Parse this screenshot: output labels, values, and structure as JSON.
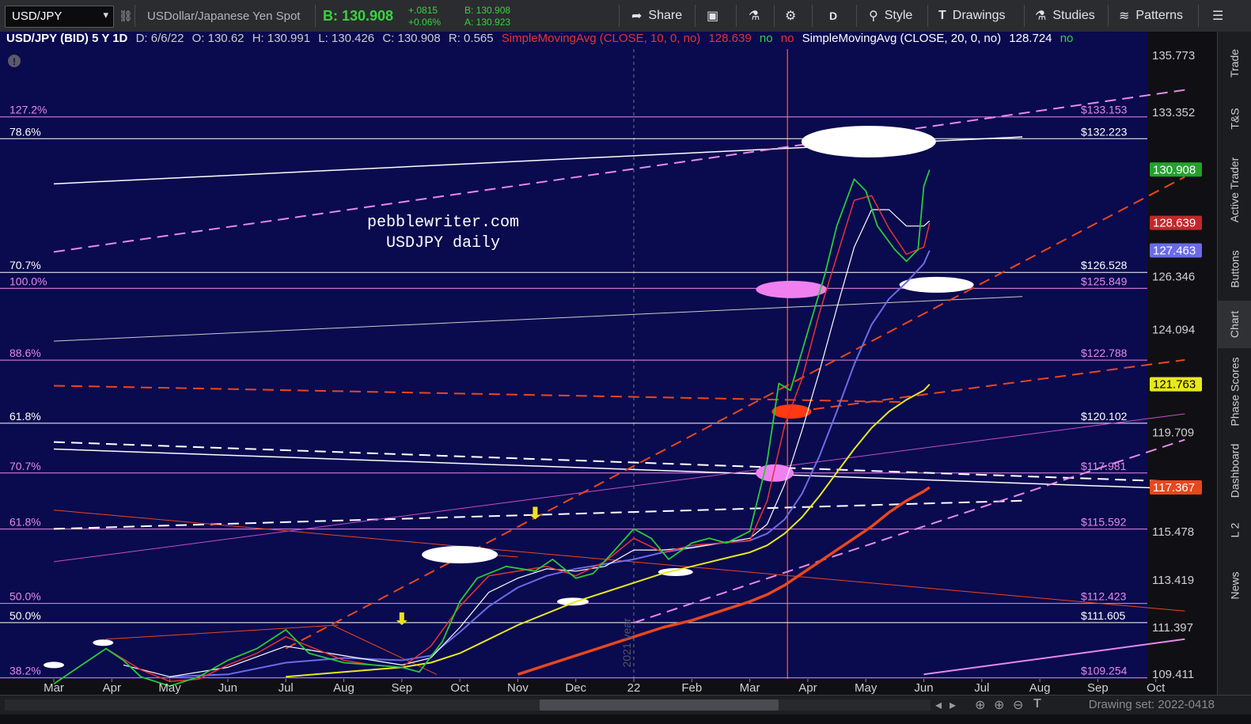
{
  "toolbar": {
    "symbol": "USD/JPY",
    "symbol_dropdown": "▾",
    "description": "USDollar/Japanese Yen Spot",
    "bid": "B: 130.908",
    "change": "+.0815",
    "change_pct": "+0.06%",
    "bid_small": "B: 130.908",
    "ask_small": "A: 130.923",
    "share": "Share",
    "period": "D",
    "style": "Style",
    "drawings": "Drawings",
    "studies": "Studies",
    "patterns": "Patterns"
  },
  "infobar": {
    "symbol_desc": "USD/JPY (BID) 5 Y 1D",
    "date": "D: 6/6/22",
    "open": "O: 130.62",
    "high": "H: 130.991",
    "low": "L: 130.426",
    "close": "C: 130.908",
    "range": "R: 0.565",
    "sma10": "SimpleMovingAvg (CLOSE, 10, 0, no)",
    "sma10_val": "128.639",
    "no1": "no",
    "no2": "no",
    "sma20": "SimpleMovingAvg (CLOSE, 20, 0, no)",
    "sma20_val": "128.724",
    "no3": "no"
  },
  "sidebar": [
    "Trade",
    "T&S",
    "Active Trader",
    "Buttons",
    "Chart",
    "Phase Scores",
    "Dashboard",
    "L 2",
    "News"
  ],
  "sidebar_active": "Chart",
  "bottombar": {
    "drawing_set": "Drawing set: 2022-0418"
  },
  "chart_data": {
    "type": "line",
    "title": "pebblewriter.com\nUSDJPY daily",
    "title_lines": [
      "pebblewriter.com",
      "USDJPY daily"
    ],
    "xlabel": "",
    "ylabel": "",
    "ylim": [
      109.41,
      135.773
    ],
    "x_tick_labels": [
      "Mar",
      "Apr",
      "May",
      "Jun",
      "Jul",
      "Aug",
      "Sep",
      "Oct",
      "Nov",
      "Dec",
      "22",
      "Feb",
      "Mar",
      "Apr",
      "May",
      "Jun",
      "Jul",
      "Aug",
      "Sep",
      "Oct"
    ],
    "x_tick_months": [
      0,
      1,
      2,
      3,
      4,
      5,
      6,
      7,
      8,
      9,
      10,
      11,
      12,
      13,
      14,
      15,
      16,
      17,
      18,
      19
    ],
    "x_start_label": "Mar 2021",
    "year_label": "2021 year",
    "y_ticks": [
      135.773,
      133.352,
      126.346,
      124.094,
      119.709,
      115.478,
      113.419,
      111.397,
      109.411
    ],
    "y_tick_labels": [
      "135.773",
      "133.352",
      "126.346",
      "124.094",
      "119.709",
      "115.478",
      "113.419",
      "111.397",
      "109.411"
    ],
    "fib_levels": [
      {
        "pct": "127.2%",
        "price": 133.153,
        "label": "$133.153",
        "color": "#e58ae8"
      },
      {
        "pct": "78.6%",
        "price": 132.223,
        "label": "$132.223",
        "color": "#ffffff"
      },
      {
        "pct": "70.7%",
        "price": 126.528,
        "label": "$126.528",
        "color": "#ffffff"
      },
      {
        "pct": "100.0%",
        "price": 125.849,
        "label": "$125.849",
        "color": "#e58ae8"
      },
      {
        "pct": "88.6%",
        "price": 122.788,
        "label": "$122.788",
        "color": "#e58ae8"
      },
      {
        "pct": "61.8%",
        "price": 120.102,
        "label": "$120.102",
        "color": "#ffffff"
      },
      {
        "pct": "70.7%",
        "price": 117.981,
        "label": "$117.981",
        "color": "#e58ae8"
      },
      {
        "pct": "61.8%",
        "price": 115.592,
        "label": "$115.592",
        "color": "#e58ae8"
      },
      {
        "pct": "50.0%",
        "price": 112.423,
        "label": "$112.423",
        "color": "#e58ae8"
      },
      {
        "pct": "50.0%",
        "price": 111.605,
        "label": "$111.605",
        "color": "#ffffff"
      },
      {
        "pct": "38.2%",
        "price": 109.254,
        "label": "$109.254",
        "color": "#e58ae8"
      }
    ],
    "price_badges": [
      {
        "price": 130.908,
        "label": "130.908",
        "bg": "#23a12d",
        "fg": "#ffffff"
      },
      {
        "price": 128.639,
        "label": "128.639",
        "bg": "#c2282b",
        "fg": "#ffffff"
      },
      {
        "price": 127.463,
        "label": "127.463",
        "bg": "#6b6be8",
        "fg": "#ffffff"
      },
      {
        "price": 121.763,
        "label": "121.763",
        "bg": "#e8e81e",
        "fg": "#000000"
      },
      {
        "price": 117.367,
        "label": "117.367",
        "bg": "#e8471e",
        "fg": "#ffffff"
      }
    ],
    "price_series": {
      "name": "",
      "x_months": [
        0,
        0.9,
        1.2,
        1.5,
        2,
        2.5,
        3,
        3.5,
        4,
        4.4,
        5,
        5.5,
        6,
        6.3,
        6.7,
        7,
        7.3,
        7.8,
        8.3,
        8.6,
        9,
        9.3,
        9.6,
        10,
        10.3,
        10.6,
        11,
        11.3,
        11.6,
        12,
        12.3,
        12.5,
        12.7,
        13,
        13.3,
        13.5,
        13.8,
        14,
        14.2,
        14.5,
        14.7,
        14.9,
        15,
        15.1
      ],
      "close": [
        109.0,
        110.5,
        110.0,
        109.3,
        108.9,
        109.3,
        110.0,
        110.5,
        111.3,
        110.3,
        109.9,
        109.8,
        109.7,
        109.5,
        110.8,
        112.5,
        113.5,
        114.0,
        113.8,
        114.3,
        113.5,
        113.7,
        114.5,
        115.6,
        115.2,
        114.3,
        115.0,
        115.2,
        115.0,
        115.5,
        118.5,
        121.8,
        121.5,
        124.0,
        126.5,
        128.5,
        130.5,
        130.0,
        128.5,
        127.5,
        127.0,
        127.5,
        130.2,
        130.9
      ]
    },
    "sma10": {
      "name": "SMA 10",
      "x_months": [
        0.9,
        1.5,
        2,
        2.5,
        3,
        3.5,
        4,
        4.4,
        5,
        5.5,
        6,
        6.5,
        7,
        7.5,
        8,
        8.5,
        9,
        9.5,
        10,
        10.5,
        11,
        11.5,
        12,
        12.3,
        12.6,
        12.9,
        13.2,
        13.5,
        13.8,
        14.1,
        14.4,
        14.7,
        15,
        15.1
      ],
      "values": [
        110.5,
        109.6,
        109.1,
        109.2,
        109.8,
        110.3,
        111.0,
        110.6,
        110.0,
        109.8,
        109.7,
        110.6,
        112.3,
        113.6,
        113.8,
        114.0,
        113.6,
        114.2,
        115.2,
        114.6,
        114.9,
        115.0,
        115.1,
        116.8,
        120.0,
        122.0,
        124.8,
        127.2,
        129.6,
        129.8,
        128.4,
        127.3,
        127.6,
        128.63
      ]
    },
    "sma20": {
      "name": "SMA 20",
      "x_months": [
        1.2,
        2,
        3,
        4,
        5,
        6,
        6.5,
        7,
        7.5,
        8,
        8.5,
        9,
        9.5,
        10,
        10.5,
        11,
        11.5,
        12,
        12.3,
        12.6,
        12.9,
        13.2,
        13.5,
        13.8,
        14.1,
        14.4,
        14.7,
        15,
        15.1
      ],
      "values": [
        109.8,
        109.3,
        109.7,
        110.6,
        110.2,
        109.8,
        110.1,
        111.4,
        112.9,
        113.5,
        113.9,
        113.8,
        114.0,
        114.7,
        114.7,
        114.8,
        115.0,
        115.2,
        115.8,
        117.5,
        119.8,
        122.3,
        125.0,
        127.6,
        129.2,
        129.2,
        128.5,
        128.5,
        128.72
      ]
    },
    "sma50": {
      "name": "",
      "color": "#6b6be8",
      "x_months": [
        2,
        3,
        4,
        5,
        6,
        6.5,
        7,
        7.5,
        8,
        8.5,
        9,
        9.5,
        10,
        10.5,
        11,
        11.5,
        12,
        12.3,
        12.6,
        12.9,
        13.2,
        13.5,
        13.8,
        14.1,
        14.4,
        14.7,
        15,
        15.1
      ],
      "values": [
        109.3,
        109.4,
        109.9,
        110.1,
        110.0,
        110.2,
        111.2,
        112.3,
        113.1,
        113.6,
        113.9,
        114.1,
        114.3,
        114.6,
        114.8,
        115.0,
        115.1,
        115.4,
        116.0,
        117.1,
        118.7,
        120.6,
        122.6,
        124.3,
        125.4,
        126.1,
        126.9,
        127.46
      ]
    },
    "sma100": {
      "name": "",
      "color": "#e8e81e",
      "x_months": [
        4,
        5,
        6,
        6.5,
        7,
        7.5,
        8,
        8.5,
        9,
        9.5,
        10,
        10.5,
        11,
        11.5,
        12,
        12.3,
        12.6,
        12.9,
        13.2,
        13.5,
        13.8,
        14.1,
        14.4,
        14.7,
        15,
        15.1
      ],
      "values": [
        109.3,
        109.5,
        109.7,
        109.9,
        110.3,
        110.9,
        111.5,
        112.0,
        112.5,
        112.9,
        113.3,
        113.7,
        114.0,
        114.3,
        114.6,
        114.9,
        115.4,
        116.1,
        117.0,
        118.0,
        119.0,
        119.9,
        120.6,
        121.1,
        121.5,
        121.76
      ]
    },
    "sma200": {
      "name": "",
      "color": "#e8471e",
      "x_months": [
        8,
        8.5,
        9,
        9.5,
        10,
        10.5,
        11,
        11.5,
        12,
        12.3,
        12.6,
        12.9,
        13.2,
        13.5,
        13.8,
        14.1,
        14.4,
        14.7,
        15,
        15.1
      ],
      "values": [
        109.4,
        109.8,
        110.2,
        110.6,
        111.0,
        111.4,
        111.7,
        112.1,
        112.5,
        112.8,
        113.2,
        113.7,
        114.2,
        114.7,
        115.2,
        115.7,
        116.3,
        116.8,
        117.2,
        117.37
      ]
    },
    "trendlines": [
      {
        "x1": 0,
        "y1": 130.3,
        "x2": 16.7,
        "y2": 132.3,
        "color": "#ffffff",
        "dash": false,
        "width": 1.5
      },
      {
        "x1": 0,
        "y1": 127.4,
        "x2": 19.5,
        "y2": 134.3,
        "color": "#e58ae8",
        "dash": true,
        "width": 2
      },
      {
        "x1": 0,
        "y1": 123.6,
        "x2": 16.7,
        "y2": 125.5,
        "color": "#cccccc",
        "dash": false,
        "width": 1
      },
      {
        "x1": 0,
        "y1": 121.7,
        "x2": 14.7,
        "y2": 121.0,
        "color": "#e8471e",
        "dash": true,
        "width": 2
      },
      {
        "x1": 0,
        "y1": 119.3,
        "x2": 19.5,
        "y2": 117.6,
        "color": "#ffffff",
        "dash": true,
        "width": 2
      },
      {
        "x1": 0,
        "y1": 119.0,
        "x2": 19.5,
        "y2": 117.3,
        "color": "#ffffff",
        "dash": false,
        "width": 1.5
      },
      {
        "x1": 0,
        "y1": 115.6,
        "x2": 16.7,
        "y2": 116.8,
        "color": "#ffffff",
        "dash": true,
        "width": 2
      },
      {
        "x1": 0,
        "y1": 114.2,
        "x2": 19.5,
        "y2": 120.5,
        "color": "#c050c8",
        "dash": false,
        "width": 1
      },
      {
        "x1": 0,
        "y1": 116.4,
        "x2": 19.5,
        "y2": 112.1,
        "color": "#e8471e",
        "dash": false,
        "width": 1
      },
      {
        "x1": 4,
        "y1": 110.5,
        "x2": 19.5,
        "y2": 130.6,
        "color": "#e8471e",
        "dash": true,
        "width": 2
      },
      {
        "x1": 12.5,
        "y1": 120.5,
        "x2": 19.5,
        "y2": 122.8,
        "color": "#e8471e",
        "dash": true,
        "width": 2
      },
      {
        "x1": 10,
        "y1": 111.6,
        "x2": 19.5,
        "y2": 119.4,
        "color": "#e58ae8",
        "dash": true,
        "width": 2
      },
      {
        "x1": 15,
        "y1": 109.4,
        "x2": 19.5,
        "y2": 110.9,
        "color": "#e58ae8",
        "dash": false,
        "width": 2
      },
      {
        "x1": 0.9,
        "y1": 110.9,
        "x2": 4.9,
        "y2": 111.5,
        "color": "#e8471e",
        "dash": false,
        "width": 1
      },
      {
        "x1": 4.8,
        "y1": 111.5,
        "x2": 6.6,
        "y2": 109.4,
        "color": "#e8471e",
        "dash": false,
        "width": 1
      },
      {
        "x1": 7,
        "y1": 114.6,
        "x2": 8,
        "y2": 114.4,
        "color": "#e8471e",
        "dash": false,
        "width": 1
      }
    ],
    "vertical_markers": [
      {
        "x": 12.65,
        "color": "#e8471e",
        "dash": false
      },
      {
        "x": 10,
        "color": "#777777",
        "dash": true
      }
    ],
    "annotations": [
      {
        "x": 14.05,
        "y": 132.1,
        "rx": 85,
        "ry": 20,
        "fill": "#ffffff"
      },
      {
        "x": 12.72,
        "y": 125.8,
        "rx": 45,
        "ry": 11,
        "fill": "#f080f0"
      },
      {
        "x": 15.22,
        "y": 126.0,
        "rx": 47,
        "ry": 10,
        "fill": "#ffffff"
      },
      {
        "x": 12.72,
        "y": 120.6,
        "rx": 25,
        "ry": 9,
        "fill": "#ff3a10"
      },
      {
        "x": 12.43,
        "y": 117.98,
        "rx": 24,
        "ry": 11,
        "fill": "#f080f0"
      },
      {
        "x": 7.0,
        "y": 114.5,
        "rx": 48,
        "ry": 11,
        "fill": "#ffffff"
      },
      {
        "x": 8.95,
        "y": 112.5,
        "rx": 20,
        "ry": 5,
        "fill": "#ffffff"
      },
      {
        "x": 10.72,
        "y": 113.76,
        "rx": 22,
        "ry": 5,
        "fill": "#ffffff"
      },
      {
        "x": 0.85,
        "y": 110.75,
        "rx": 13,
        "ry": 4,
        "fill": "#ffffff"
      },
      {
        "x": 0.0,
        "y": 109.8,
        "rx": 13,
        "ry": 4,
        "fill": "#ffffff"
      }
    ],
    "arrows": [
      {
        "x": 8.3,
        "y": 116.0,
        "color": "#f0e020"
      },
      {
        "x": 6.0,
        "y": 111.5,
        "color": "#f0e020"
      }
    ]
  }
}
